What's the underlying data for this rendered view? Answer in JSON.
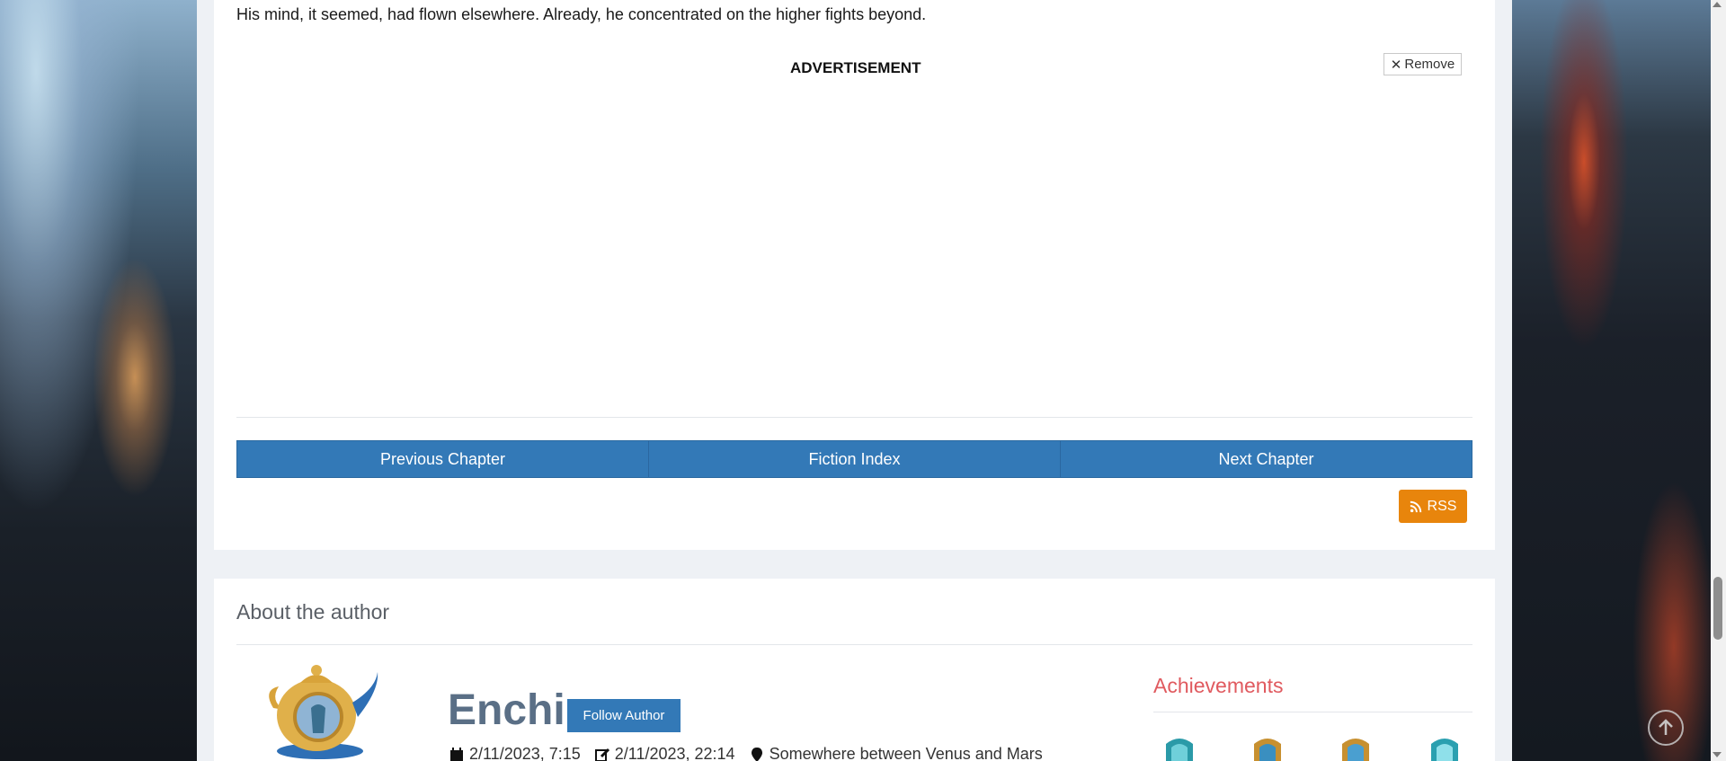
{
  "chapter": {
    "text_line": "His mind, it seemed, had flown elsewhere. Already, he concentrated on the higher fights beyond."
  },
  "advertisement": {
    "label": "ADVERTISEMENT",
    "remove_label": "Remove"
  },
  "navigation": {
    "previous_label": "Previous Chapter",
    "index_label": "Fiction Index",
    "next_label": "Next Chapter",
    "rss_label": "RSS"
  },
  "about": {
    "title": "About the author",
    "author_name": "Enchi",
    "follow_label": "Follow Author",
    "joined": "2/11/2023, 7:15",
    "last_active": "2/11/2023, 22:14",
    "location": "Somewhere between Venus and Mars",
    "achievements_title": "Achievements"
  },
  "colors": {
    "primary_blue": "#3379b7",
    "rss_orange": "#e8850c",
    "achievements_red": "#e05a5f",
    "author_name": "#5a6f86"
  },
  "icons": {
    "remove": "close-icon",
    "rss": "rss-icon",
    "joined": "calendar-icon",
    "last_active": "edit-icon",
    "location": "map-marker-icon",
    "back_to_top": "arrow-up-icon"
  }
}
